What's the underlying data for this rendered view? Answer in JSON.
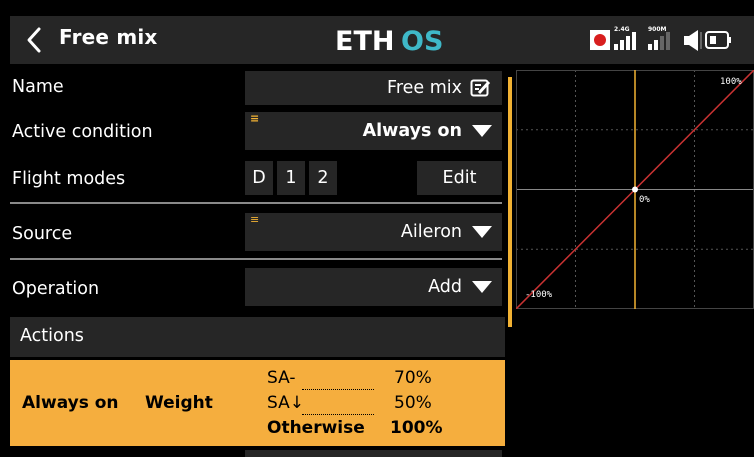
{
  "header": {
    "title": "Free mix",
    "logo": {
      "left": "ETH",
      "right": "OS"
    },
    "status": {
      "rx_band": "2.4G",
      "telemetry_band": "900M"
    }
  },
  "rows": {
    "name": {
      "label": "Name",
      "value": "Free mix"
    },
    "active_condition": {
      "label": "Active condition",
      "value": "Always on"
    },
    "flight_modes": {
      "label": "Flight modes",
      "modes": [
        "D",
        "1",
        "2"
      ],
      "edit_label": "Edit"
    },
    "source": {
      "label": "Source",
      "value": "Aileron"
    },
    "operation": {
      "label": "Operation",
      "value": "Add"
    }
  },
  "actions": {
    "header": "Actions",
    "row": {
      "condition": "Always on",
      "type": "Weight",
      "entries": [
        {
          "switch": "SA-",
          "value": "70%"
        },
        {
          "switch": "SA↓",
          "value": "50%"
        },
        {
          "switch": "Otherwise",
          "value": "100%"
        }
      ]
    }
  },
  "graph": {
    "label_top_right": "100%",
    "label_center": "0%",
    "label_bottom_left": "-100%"
  },
  "chart_data": {
    "type": "line",
    "x": [
      -100,
      0,
      100
    ],
    "y": [
      -100,
      0,
      100
    ],
    "xlim": [
      -100,
      100
    ],
    "ylim": [
      -100,
      100
    ],
    "marker": {
      "x": 0,
      "y": 0
    },
    "grid": true,
    "colors": {
      "line": "#c83232",
      "cursor": "#f2b233",
      "grid": "#555555"
    }
  },
  "colors": {
    "accent": "#f5ae3e",
    "field_bg": "#262626",
    "logo_accent": "#3fb8c8"
  }
}
